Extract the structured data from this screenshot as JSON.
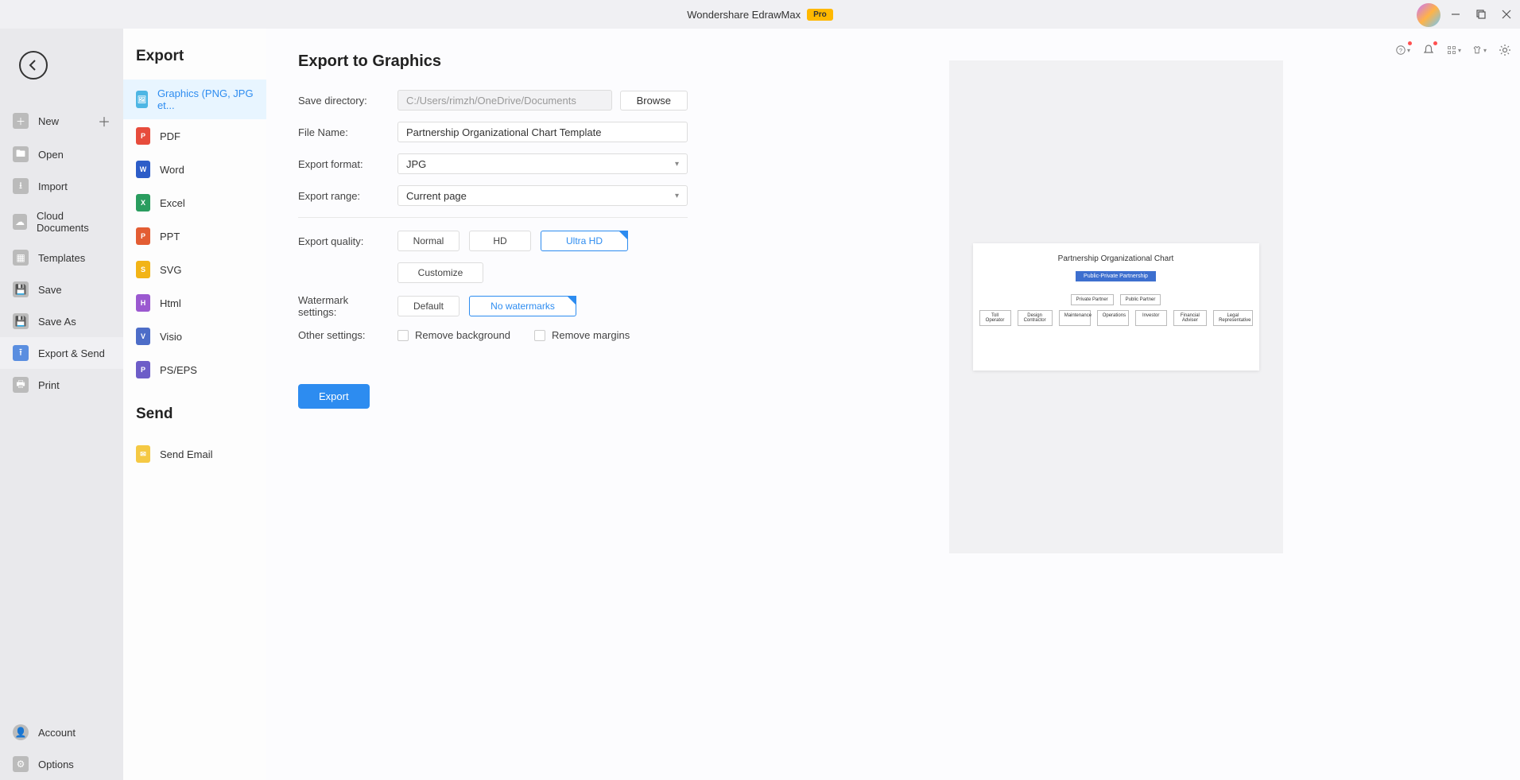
{
  "app": {
    "title": "Wondershare EdrawMax",
    "badge": "Pro"
  },
  "nav1": {
    "new": "New",
    "open": "Open",
    "import": "Import",
    "cloud": "Cloud Documents",
    "templates": "Templates",
    "save": "Save",
    "saveas": "Save As",
    "export": "Export & Send",
    "print": "Print",
    "account": "Account",
    "options": "Options"
  },
  "nav2": {
    "export_title": "Export",
    "send_title": "Send",
    "graphics": "Graphics (PNG, JPG et...",
    "pdf": "PDF",
    "word": "Word",
    "excel": "Excel",
    "ppt": "PPT",
    "svg": "SVG",
    "html": "Html",
    "visio": "Visio",
    "ps": "PS/EPS",
    "sendemail": "Send Email"
  },
  "form": {
    "title": "Export to Graphics",
    "save_dir_label": "Save directory:",
    "save_dir_value": "C:/Users/rimzh/OneDrive/Documents",
    "browse": "Browse",
    "filename_label": "File Name:",
    "filename_value": "Partnership Organizational Chart Template",
    "format_label": "Export format:",
    "format_value": "JPG",
    "range_label": "Export range:",
    "range_value": "Current page",
    "quality_label": "Export quality:",
    "q_normal": "Normal",
    "q_hd": "HD",
    "q_uhd": "Ultra HD",
    "customize": "Customize",
    "watermark_label": "Watermark settings:",
    "w_default": "Default",
    "w_none": "No watermarks",
    "other_label": "Other settings:",
    "remove_bg": "Remove background",
    "remove_margins": "Remove margins",
    "export_btn": "Export"
  },
  "preview": {
    "chart_title": "Partnership Organizational Chart",
    "root": "Public-Private Partnership",
    "mid1": "Private Partner",
    "mid2": "Public Partner",
    "leaves": [
      "Toll Operator",
      "Design Contractor",
      "Maintenance",
      "Operations",
      "Investor",
      "Financial Adviser",
      "Legal Representative"
    ]
  }
}
